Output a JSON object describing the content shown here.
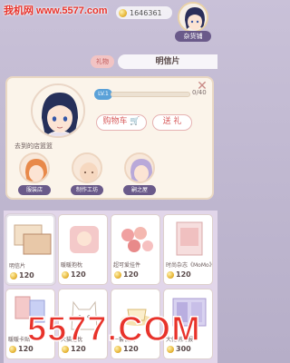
{
  "watermark": {
    "top": "我机网 www.5577.com",
    "bottom": "5577.COM"
  },
  "currency": {
    "icon": "coin-icon",
    "value": "1646361"
  },
  "shopkeeper": {
    "label": "杂货铺"
  },
  "tabs": {
    "small": "礼物",
    "main": "明信片"
  },
  "panel": {
    "level_badge": "LV.1",
    "level_count": "0/40",
    "cart_button": "购物车",
    "gift_button": "送 礼",
    "visited_label": "去到的店篮篮",
    "shops": [
      {
        "label": "服装店"
      },
      {
        "label": "制作工坊"
      },
      {
        "label": "嗣之屋"
      }
    ]
  },
  "items": [
    {
      "name": "明信片",
      "price": "120"
    },
    {
      "name": "暖暖抱枕",
      "price": "120"
    },
    {
      "name": "超可爱挂件",
      "price": "120"
    },
    {
      "name": "时尚杂志《MoMo》",
      "price": "120"
    },
    {
      "name": "暖暖卡贴",
      "price": "120"
    },
    {
      "name": "大猫抱枕",
      "price": "120"
    },
    {
      "name": "一套餐具",
      "price": "120"
    },
    {
      "name": "大促销海报",
      "price": "300"
    }
  ],
  "colors": {
    "accent": "#d75a5a",
    "badge": "#6a5a8a",
    "watermark": "#e8332b"
  }
}
